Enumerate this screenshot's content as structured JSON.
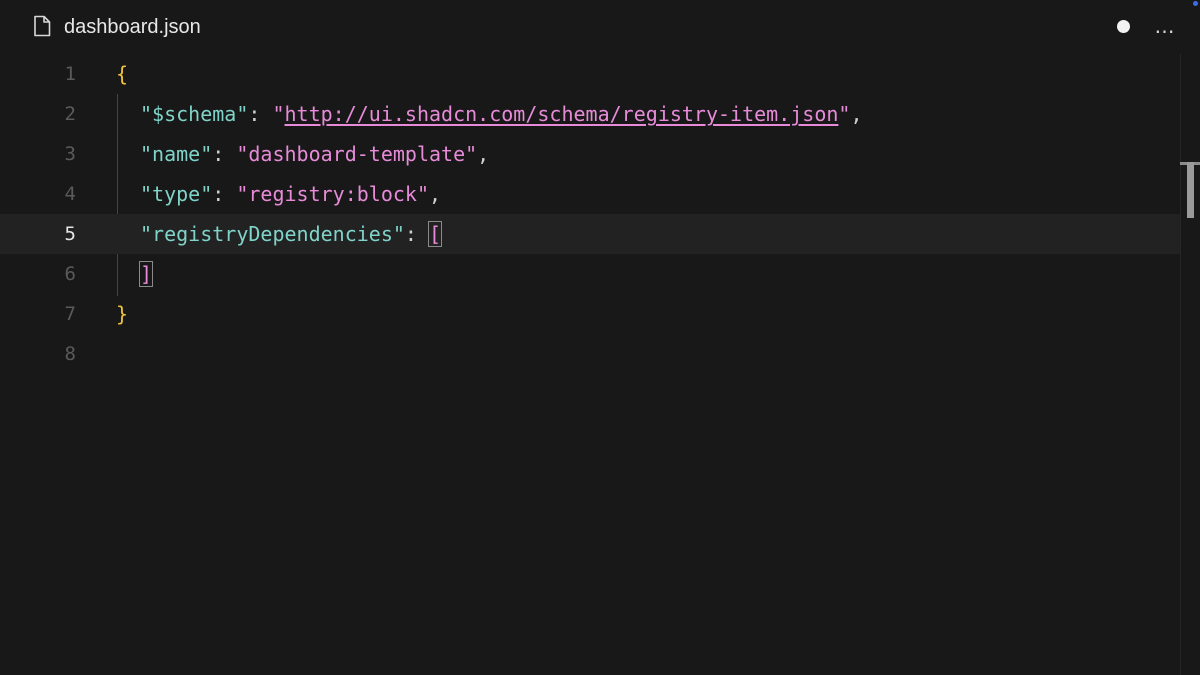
{
  "tab": {
    "title": "dashboard.json",
    "icon": "file-icon",
    "more_label": "…"
  },
  "editor": {
    "current_line": 5,
    "lines": [
      {
        "number": "1",
        "text": "{"
      },
      {
        "number": "2",
        "key": "\"$schema\"",
        "sep": ": ",
        "value": "\"http://ui.shadcn.com/schema/registry-item.json\"",
        "url": "http://ui.shadcn.com/schema/registry-item.json",
        "trail": ","
      },
      {
        "number": "3",
        "key": "\"name\"",
        "sep": ": ",
        "value": "\"dashboard-template\"",
        "trail": ","
      },
      {
        "number": "4",
        "key": "\"type\"",
        "sep": ": ",
        "value": "\"registry:block\"",
        "trail": ","
      },
      {
        "number": "5",
        "key": "\"registryDependencies\"",
        "sep": ": ",
        "value": "["
      },
      {
        "number": "6",
        "value": "]"
      },
      {
        "number": "7",
        "text": "}"
      },
      {
        "number": "8"
      }
    ]
  },
  "colors": {
    "background": "#181818",
    "key": "#7fd3c8",
    "string": "#e78bd8",
    "brace": "#f0c23c",
    "accent": "#3b6de8"
  }
}
